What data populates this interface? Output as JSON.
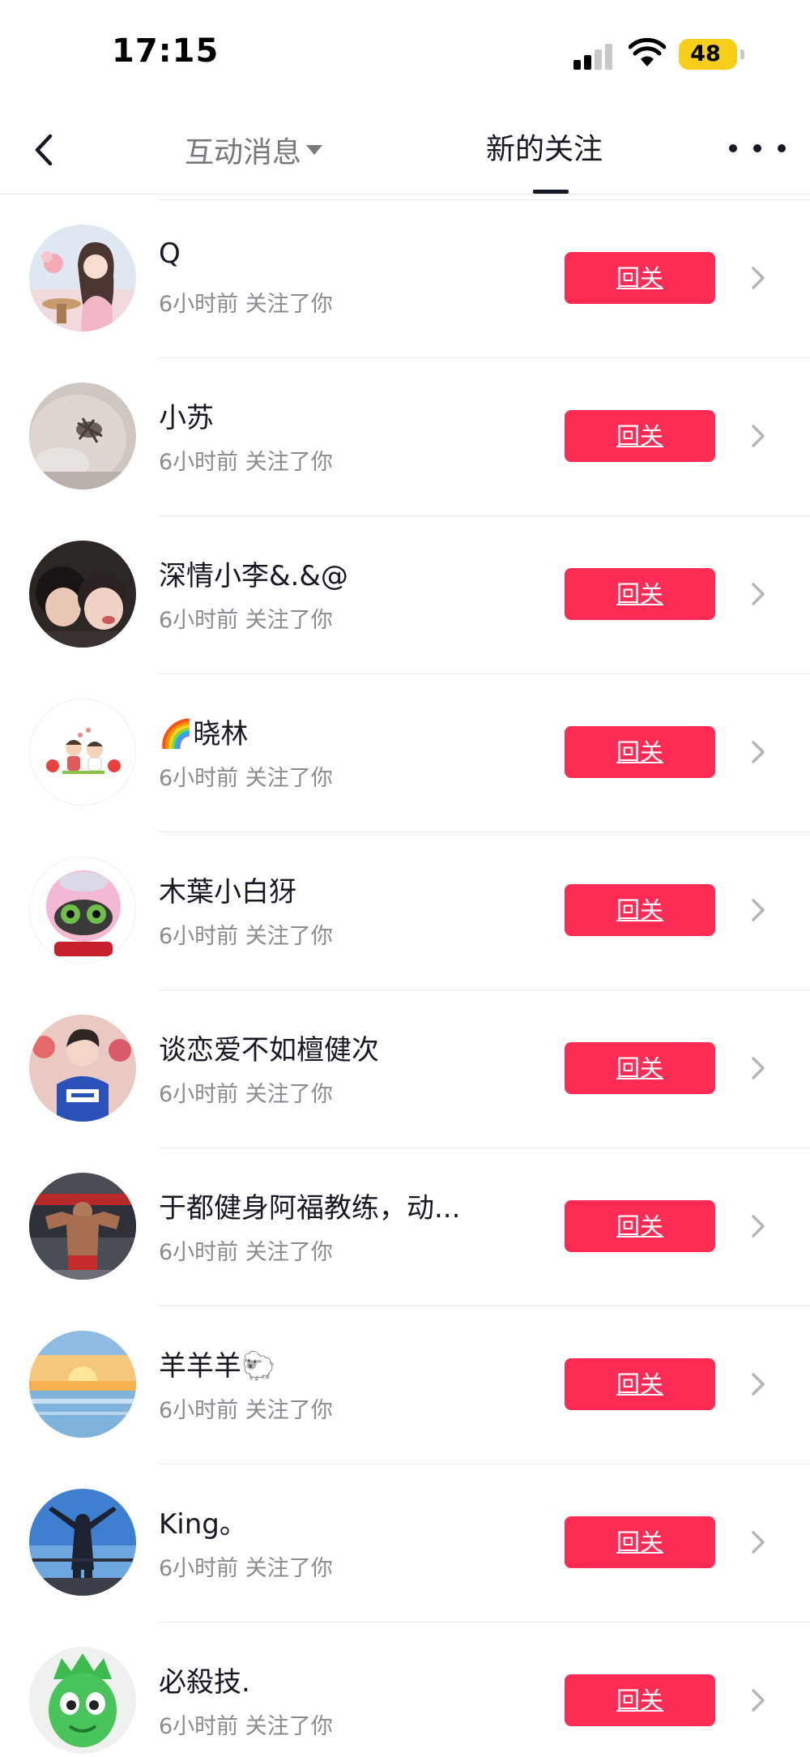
{
  "status_bar": {
    "time": "17:15",
    "battery": "48"
  },
  "nav": {
    "tab_interactions": "互动消息",
    "tab_new_follows": "新的关注"
  },
  "followers": [
    {
      "name": "Q",
      "subtitle": "6小时前 关注了你",
      "button": "回关"
    },
    {
      "name": "小苏",
      "subtitle": "6小时前 关注了你",
      "button": "回关"
    },
    {
      "name": "深情小李&.&@",
      "subtitle": "6小时前 关注了你",
      "button": "回关"
    },
    {
      "name": "🌈晓林",
      "subtitle": "6小时前 关注了你",
      "button": "回关"
    },
    {
      "name": "木葉小白犽",
      "subtitle": "6小时前 关注了你",
      "button": "回关"
    },
    {
      "name": "谈恋爱不如檀健次",
      "subtitle": "6小时前 关注了你",
      "button": "回关"
    },
    {
      "name": "于都健身阿福教练，动...",
      "subtitle": "6小时前 关注了你",
      "button": "回关"
    },
    {
      "name": "羊羊羊🐑",
      "subtitle": "6小时前 关注了你",
      "button": "回关"
    },
    {
      "name": "King。",
      "subtitle": "6小时前 关注了你",
      "button": "回关"
    },
    {
      "name": "必殺技.",
      "subtitle": "6小时前 关注了你",
      "button": "回关"
    }
  ],
  "colors": {
    "accent": "#fe2c55",
    "text": "#161823",
    "secondary": "#8a8b91",
    "battery": "#f7ce19"
  }
}
